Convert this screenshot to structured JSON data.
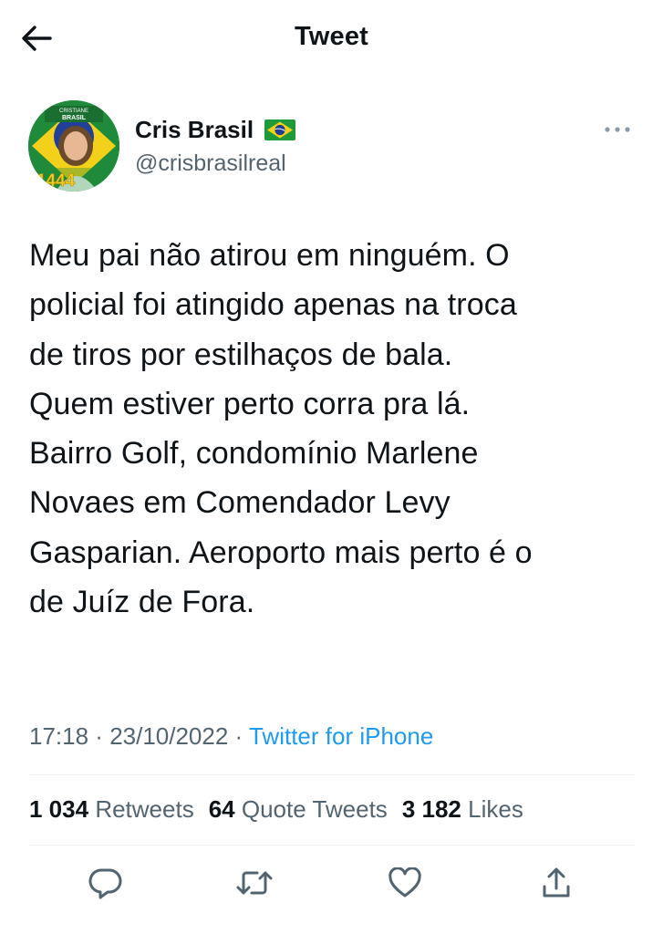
{
  "header": {
    "title": "Tweet",
    "back_icon": "arrow-left-icon"
  },
  "author": {
    "name": "Cris Brasil",
    "flag_icon": "brazil-flag-icon",
    "handle": "@crisbrasilreal",
    "avatar": {
      "badge_line1": "CRISTIANE",
      "badge_line2": "BRASIL",
      "number": "1444"
    }
  },
  "tweet": {
    "text": "Meu pai não atirou em ninguém. O\npolicial foi atingido apenas na troca\nde tiros por estilhaços de bala.\nQuem estiver perto corra pra lá.\nBairro Golf, condomínio Marlene\nNovaes em Comendador Levy\nGasparian. Aeroporto mais perto é o\nde Juíz de Fora."
  },
  "meta": {
    "time": "17:18",
    "separator": " · ",
    "date": "23/10/2022",
    "source": "Twitter for iPhone"
  },
  "stats": {
    "retweets_count": "1 034",
    "retweets_label": "Retweets",
    "quotes_count": "64",
    "quotes_label": "Quote Tweets",
    "likes_count": "3 182",
    "likes_label": "Likes"
  },
  "actions": [
    "reply-icon",
    "retweet-icon",
    "like-icon",
    "share-icon"
  ],
  "colors": {
    "text": "#0f1419",
    "secondary": "#536471",
    "accent": "#1d9bf0",
    "divider": "#eff3f4",
    "flag_green": "#1f9a3b",
    "flag_yellow": "#f7d117",
    "flag_blue": "#1f3f95"
  }
}
